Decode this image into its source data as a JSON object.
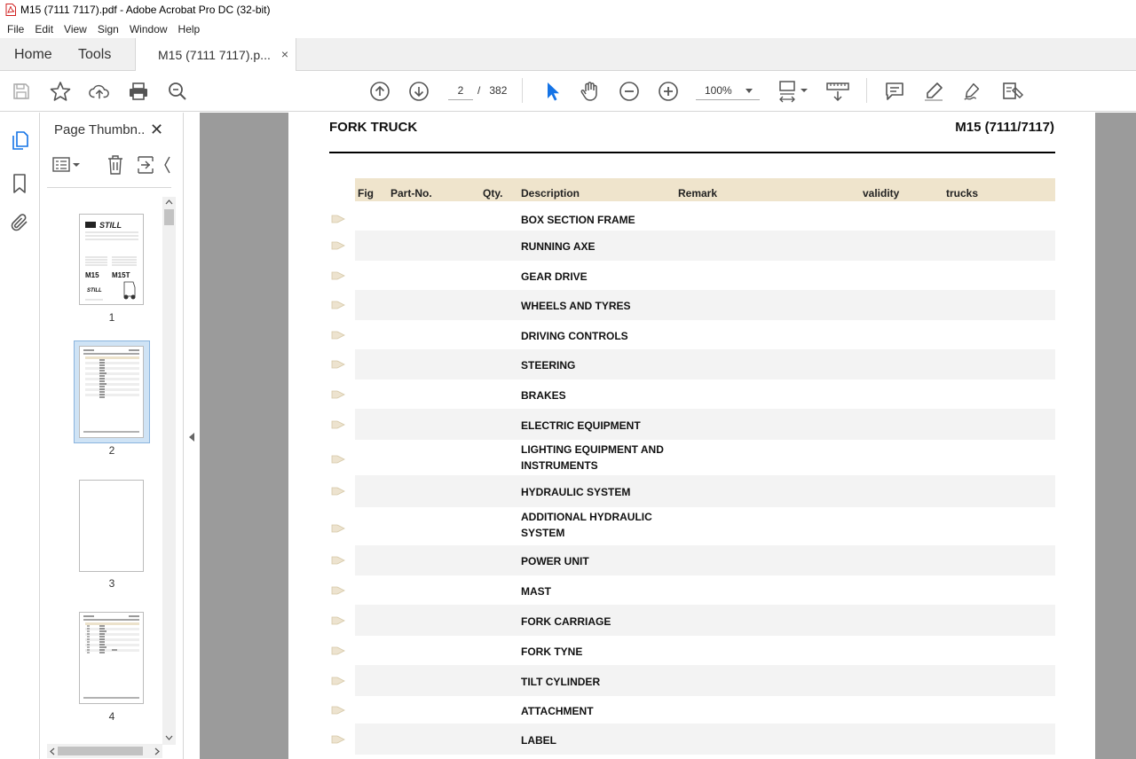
{
  "window": {
    "title": "M15 (7111 7117).pdf - Adobe Acrobat Pro DC (32-bit)"
  },
  "menu": [
    "File",
    "Edit",
    "View",
    "Sign",
    "Window",
    "Help"
  ],
  "tabs": {
    "home": "Home",
    "tools": "Tools",
    "document": "M15 (7111 7117).p...",
    "close": "×"
  },
  "toolbar": {
    "current_page": "2",
    "separator": "/",
    "total_pages": "382",
    "zoom": "100%"
  },
  "thumbnails_panel": {
    "title": "Page Thumbn...",
    "close": "✕",
    "pages": [
      "1",
      "2",
      "3",
      "4"
    ]
  },
  "document": {
    "header_left": "FORK TRUCK",
    "header_right": "M15 (7111/7117)",
    "columns": {
      "fig": "Fig",
      "part_no": "Part-No.",
      "qty": "Qty.",
      "description": "Description",
      "remark": "Remark",
      "validity": "validity",
      "trucks": "trucks"
    },
    "rows": [
      "BOX SECTION FRAME",
      "RUNNING AXE",
      "GEAR DRIVE",
      "WHEELS AND TYRES",
      "DRIVING CONTROLS",
      "STEERING",
      "BRAKES",
      "ELECTRIC EQUIPMENT",
      "LIGHTING EQUIPMENT AND INSTRUMENTS",
      "HYDRAULIC SYSTEM",
      "ADDITIONAL HYDRAULIC SYSTEM",
      "POWER UNIT",
      "MAST",
      "FORK CARRIAGE",
      "FORK TYNE",
      "TILT CYLINDER",
      "ATTACHMENT",
      "LABEL"
    ]
  },
  "colors": {
    "header_band": "#efe4cc",
    "row_shade": "#f3f3f3",
    "workspace": "#9b9b9b",
    "accent": "#1473e6"
  }
}
